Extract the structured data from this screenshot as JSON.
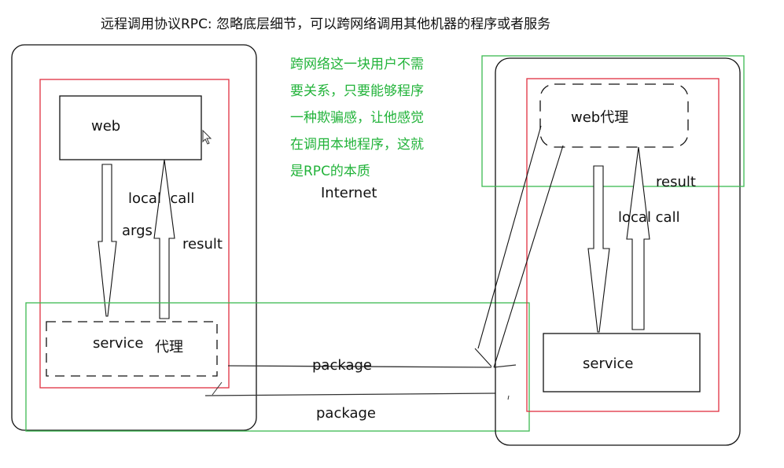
{
  "title": "远程调用协议RPC: 忽略底层细节，可以跨网络调用其他机器的程序或者服务",
  "note_lines": [
    "跨网络这一块用户不需",
    "要关系，只要能够程序",
    "一种欺骗感，让他感觉",
    "在调用本地程序，这就",
    "是RPC的本质"
  ],
  "internet_label": "Internet",
  "left_machine": {
    "web_label": "web",
    "local_call_label": "local  call",
    "args_label": "args",
    "result_label": "result",
    "service_proxy_label": "service",
    "service_proxy_suffix": "代理"
  },
  "right_machine": {
    "web_proxy_label": "web代理",
    "result_label": "result",
    "local_call_label": "local call",
    "service_label": "service"
  },
  "network": {
    "package_top_label": "package",
    "package_bottom_label": "package"
  },
  "colors": {
    "red_box": "#e03040",
    "green_box": "#3cba50",
    "note_text": "#22b33a",
    "stroke": "#111111"
  }
}
